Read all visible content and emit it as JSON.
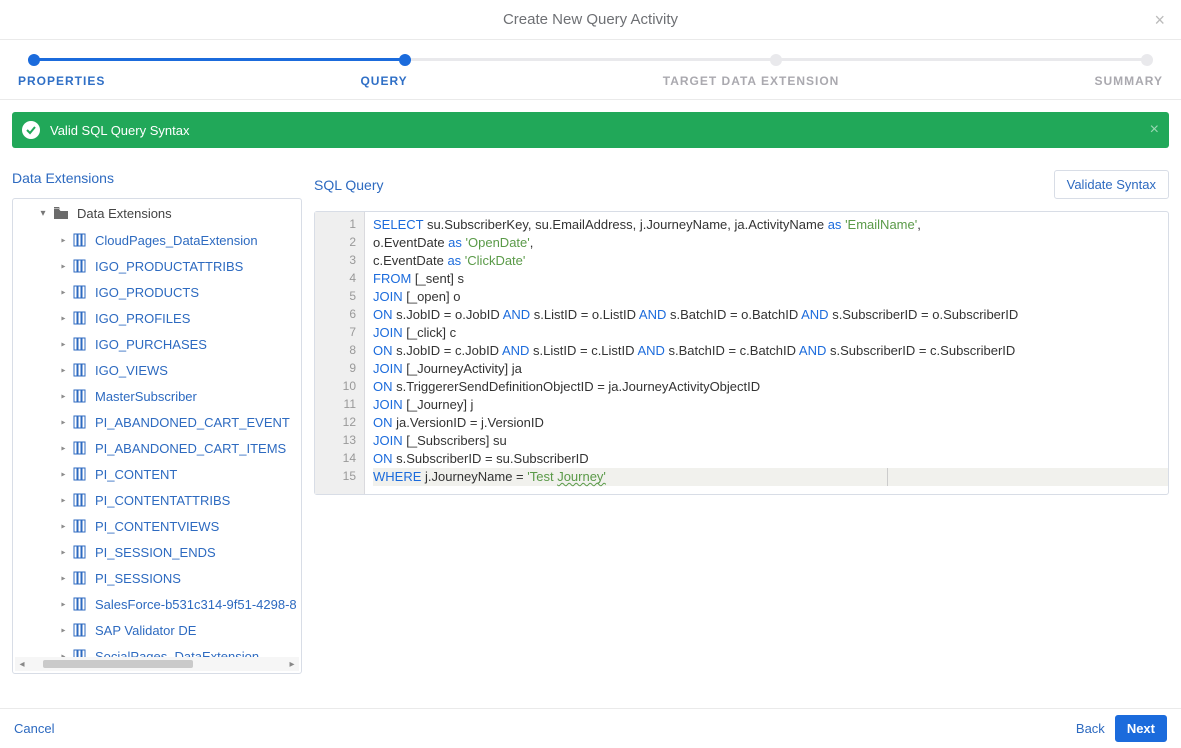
{
  "dialog": {
    "title": "Create New Query Activity",
    "close_glyph": "×"
  },
  "wizard": {
    "steps": [
      "PROPERTIES",
      "QUERY",
      "TARGET DATA EXTENSION",
      "SUMMARY"
    ],
    "active_index": 1
  },
  "banner": {
    "text": "Valid SQL Query Syntax",
    "close_glyph": "×"
  },
  "left": {
    "heading": "Data Extensions",
    "root_label": "Data Extensions",
    "items": [
      "CloudPages_DataExtension",
      "IGO_PRODUCTATTRIBS",
      "IGO_PRODUCTS",
      "IGO_PROFILES",
      "IGO_PURCHASES",
      "IGO_VIEWS",
      "MasterSubscriber",
      "PI_ABANDONED_CART_EVENT",
      "PI_ABANDONED_CART_ITEMS",
      "PI_CONTENT",
      "PI_CONTENTATTRIBS",
      "PI_CONTENTVIEWS",
      "PI_SESSION_ENDS",
      "PI_SESSIONS",
      "SalesForce-b531c314-9f51-4298-8",
      "SAP Validator DE",
      "SocialPages_DataExtension"
    ]
  },
  "right": {
    "heading": "SQL Query",
    "validate_btn": "Validate Syntax",
    "line_count": 15,
    "sql": {
      "l1_a": "SELECT",
      "l1_b": " su.SubscriberKey, su.EmailAddress, j.JourneyName, ja.ActivityName ",
      "l1_c": "as",
      "l1_d": " ",
      "l1_e": "'EmailName'",
      "l1_f": ",",
      "l2_a": "o.EventDate ",
      "l2_b": "as",
      "l2_c": " ",
      "l2_d": "'OpenDate'",
      "l2_e": ",",
      "l3_a": "c.EventDate ",
      "l3_b": "as",
      "l3_c": " ",
      "l3_d": "'ClickDate'",
      "l4_a": "FROM",
      "l4_b": " [_sent] s",
      "l5_a": "JOIN",
      "l5_b": " [_open] o",
      "l6_a": "ON",
      "l6_b": " s.JobID = o.JobID ",
      "l6_c": "AND",
      "l6_d": " s.ListID = o.ListID ",
      "l6_e": "AND",
      "l6_f": " s.BatchID = o.BatchID ",
      "l6_g": "AND",
      "l6_h": " s.SubscriberID = o.SubscriberID",
      "l7_a": "JOIN",
      "l7_b": " [_click] c",
      "l8_a": "ON",
      "l8_b": " s.JobID = c.JobID ",
      "l8_c": "AND",
      "l8_d": " s.ListID = c.ListID ",
      "l8_e": "AND",
      "l8_f": " s.BatchID = c.BatchID ",
      "l8_g": "AND",
      "l8_h": " s.SubscriberID = c.SubscriberID",
      "l9_a": "JOIN",
      "l9_b": " [_JourneyActivity] ja",
      "l10_a": "ON",
      "l10_b": " s.TriggererSendDefinitionObjectID = ja.JourneyActivityObjectID",
      "l11_a": "JOIN",
      "l11_b": " [_Journey] j",
      "l12_a": "ON",
      "l12_b": " ja.VersionID = j.VersionID",
      "l13_a": "JOIN",
      "l13_b": " [_Subscribers] su",
      "l14_a": "ON",
      "l14_b": " s.SubscriberID = su.SubscriberID",
      "l15_a": "WHERE",
      "l15_b": " j.JourneyName = ",
      "l15_c": "'Test ",
      "l15_d": "Journey'"
    }
  },
  "footer": {
    "cancel": "Cancel",
    "back": "Back",
    "next": "Next"
  }
}
